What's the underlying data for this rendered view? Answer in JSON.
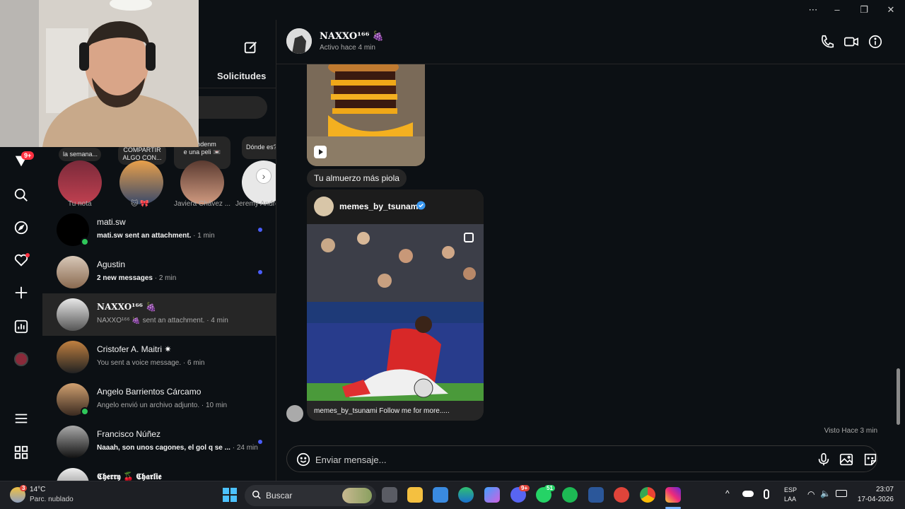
{
  "window": {
    "menu_icon": "more-horizontal-icon"
  },
  "sidebar": {
    "notifications_badge": "9+",
    "items": [
      "home-icon",
      "search-icon",
      "explore-icon",
      "heart-icon",
      "create-icon",
      "dashboard-icon",
      "profile-icon",
      "menu-icon",
      "apps-icon"
    ]
  },
  "list": {
    "requests_tab": "Solicitudes",
    "notes": [
      {
        "bubble": "la semana...",
        "name": "Tu nota"
      },
      {
        "bubble": "COMPARTIR\nALGO CON...",
        "name": "🐱 🎀"
      },
      {
        "bubble": "aiendenm\ne una peli 📼",
        "name": "Javiera Chávez ..."
      },
      {
        "bubble": "Dónde es?",
        "name": "Jeremy Andre"
      }
    ],
    "conversations": [
      {
        "name": "mati.sw",
        "preview_strong": "mati.sw sent an attachment.",
        "time": " · 1 min",
        "online": true,
        "unread": true,
        "active": false
      },
      {
        "name": "Agustin",
        "preview_strong": "2 new messages",
        "time": " · 2 min",
        "online": false,
        "unread": true,
        "active": false
      },
      {
        "name": "NAXXO¹⁶⁶ 🍇",
        "preview": "NAXXO¹⁶⁶ 🍇 sent an attachment.",
        "time": " · 4 min",
        "online": false,
        "unread": false,
        "active": true
      },
      {
        "name": "Cristofer A. Maitri ✷",
        "preview": "You sent a voice message.",
        "time": " · 6 min",
        "online": false,
        "unread": false,
        "active": false
      },
      {
        "name": "Angelo Barrientos Cárcamo",
        "preview": "Angelo envió un archivo adjunto.",
        "time": " · 10 min",
        "online": true,
        "unread": false,
        "active": false
      },
      {
        "name": "Francisco Núñez",
        "preview_strong": "Naaah, son unos cagones, el gol q se ...",
        "time": " · 24 min",
        "online": false,
        "unread": true,
        "active": false
      },
      {
        "name": "𝕮𝖍𝖊𝖗𝖗𝖞 🍒 𝕮𝖍𝖆𝖗𝖑𝖎𝖊",
        "preview": "",
        "time": "",
        "online": false,
        "unread": false,
        "active": false
      }
    ]
  },
  "chat": {
    "contact_name": "NAXXO¹⁶⁶ 🍇",
    "status": "Activo hace 4 min",
    "caption": "Tu almuerzo más piola",
    "shared_user": "memes_by_tsunami",
    "shared_caption": "memes_by_tsunami Follow me for more.....",
    "seen": "Visto Hace 3 min",
    "composer_placeholder": "Enviar mensaje..."
  },
  "taskbar": {
    "temperature": "14°C",
    "weather": "Parc. nublado",
    "weather_badge": "3",
    "search_label": "Buscar",
    "discord_badge": "9+",
    "whatsapp_badge": "51",
    "lang1": "ESP",
    "lang2": "LAA",
    "time": "23:07",
    "date": "17-04-2026"
  },
  "colors": {
    "background": "#0c1014",
    "active_row": "#262626",
    "unread_dot": "#4a5df9",
    "online": "#2fc75a",
    "badge": "#ff3040"
  }
}
